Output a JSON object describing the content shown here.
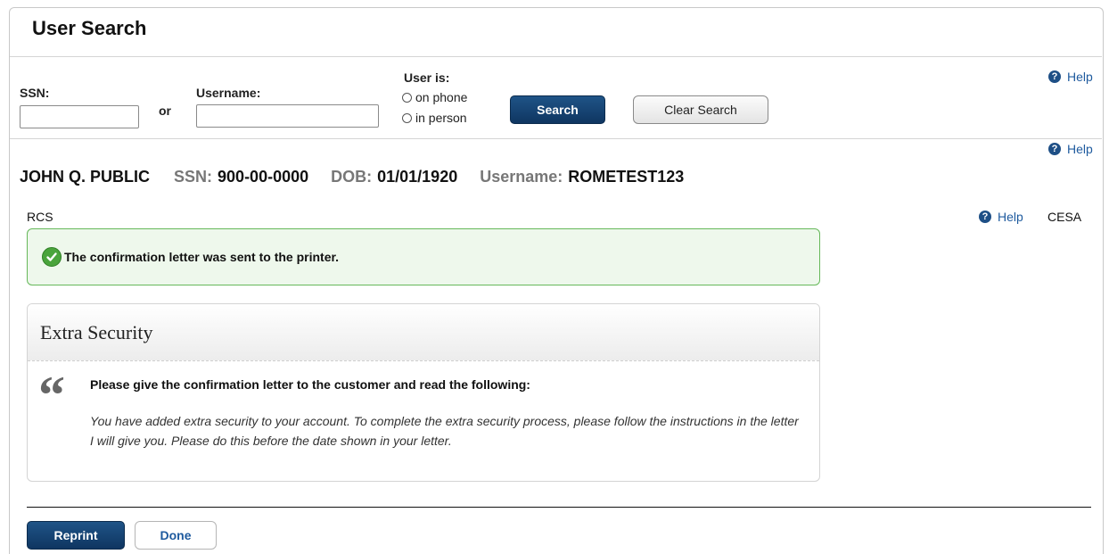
{
  "page": {
    "title": "User Search"
  },
  "search": {
    "ssn_label": "SSN:",
    "ssn_value": "",
    "or_label": "or",
    "username_label": "Username:",
    "username_value": "",
    "user_is_label": "User is:",
    "radio_options": [
      "on phone",
      "in person"
    ],
    "search_button": "Search",
    "clear_button": "Clear Search",
    "help_label": "Help"
  },
  "person": {
    "name": "JOHN Q. PUBLIC",
    "ssn_key": "SSN:",
    "ssn_value": "900-00-0000",
    "dob_key": "DOB:",
    "dob_value": "01/01/1920",
    "username_key": "Username:",
    "username_value": "ROMETEST123",
    "help_label": "Help"
  },
  "section": {
    "left_label": "RCS",
    "help_label": "Help",
    "right_label": "CESA"
  },
  "alert": {
    "message": "The confirmation letter was sent to the printer.",
    "color": "#4aa43c"
  },
  "panel": {
    "title": "Extra Security",
    "lead": "Please give the confirmation letter to the customer and read the following:",
    "body": "You have added extra security to your account. To complete the extra security process, please follow the instructions in the letter I will give you. Please do this before the date shown in your letter."
  },
  "actions": {
    "reprint": "Reprint",
    "done": "Done"
  },
  "colors": {
    "primary": "#143f6d",
    "link": "#1e5a9e"
  }
}
